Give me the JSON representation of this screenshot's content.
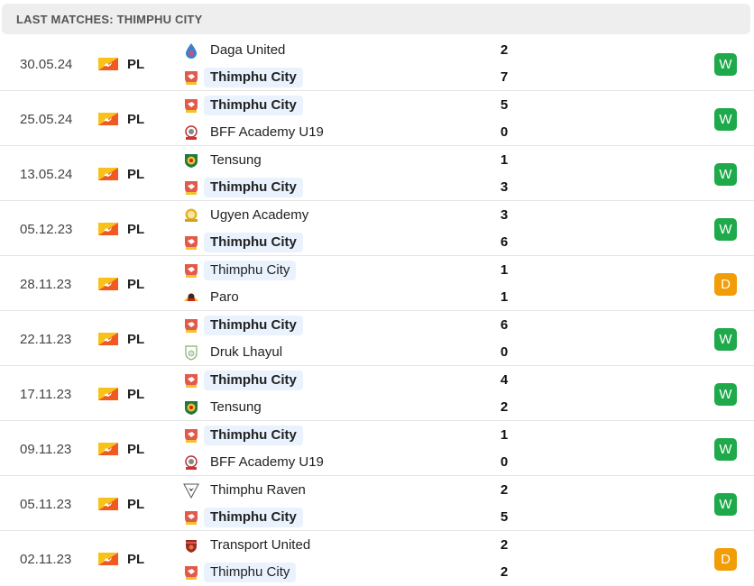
{
  "header": {
    "title": "LAST MATCHES: THIMPHU CITY"
  },
  "colors": {
    "win": "#1ea94a",
    "draw": "#f29c06",
    "highlight": "#e9f2fd"
  },
  "matches": [
    {
      "date": "30.05.24",
      "competition": "PL",
      "country_flag": "bhutan-flag-icon",
      "home": {
        "name": "Daga United",
        "crest": "daga-united-crest-icon",
        "score": "2",
        "highlight": false,
        "bold": false
      },
      "away": {
        "name": "Thimphu City",
        "crest": "thimphu-city-crest-icon",
        "score": "7",
        "highlight": true,
        "bold": true
      },
      "result": "W"
    },
    {
      "date": "25.05.24",
      "competition": "PL",
      "country_flag": "bhutan-flag-icon",
      "home": {
        "name": "Thimphu City",
        "crest": "thimphu-city-crest-icon",
        "score": "5",
        "highlight": true,
        "bold": true
      },
      "away": {
        "name": "BFF Academy U19",
        "crest": "bff-academy-crest-icon",
        "score": "0",
        "highlight": false,
        "bold": false
      },
      "result": "W"
    },
    {
      "date": "13.05.24",
      "competition": "PL",
      "country_flag": "bhutan-flag-icon",
      "home": {
        "name": "Tensung",
        "crest": "tensung-crest-icon",
        "score": "1",
        "highlight": false,
        "bold": false
      },
      "away": {
        "name": "Thimphu City",
        "crest": "thimphu-city-crest-icon",
        "score": "3",
        "highlight": true,
        "bold": true
      },
      "result": "W"
    },
    {
      "date": "05.12.23",
      "competition": "PL",
      "country_flag": "bhutan-flag-icon",
      "home": {
        "name": "Ugyen Academy",
        "crest": "ugyen-academy-crest-icon",
        "score": "3",
        "highlight": false,
        "bold": false
      },
      "away": {
        "name": "Thimphu City",
        "crest": "thimphu-city-crest-icon",
        "score": "6",
        "highlight": true,
        "bold": true
      },
      "result": "W"
    },
    {
      "date": "28.11.23",
      "competition": "PL",
      "country_flag": "bhutan-flag-icon",
      "home": {
        "name": "Thimphu City",
        "crest": "thimphu-city-crest-icon",
        "score": "1",
        "highlight": true,
        "bold": false
      },
      "away": {
        "name": "Paro",
        "crest": "paro-crest-icon",
        "score": "1",
        "highlight": false,
        "bold": false
      },
      "result": "D"
    },
    {
      "date": "22.11.23",
      "competition": "PL",
      "country_flag": "bhutan-flag-icon",
      "home": {
        "name": "Thimphu City",
        "crest": "thimphu-city-crest-icon",
        "score": "6",
        "highlight": true,
        "bold": true
      },
      "away": {
        "name": "Druk Lhayul",
        "crest": "druk-lhayul-crest-icon",
        "score": "0",
        "highlight": false,
        "bold": false
      },
      "result": "W"
    },
    {
      "date": "17.11.23",
      "competition": "PL",
      "country_flag": "bhutan-flag-icon",
      "home": {
        "name": "Thimphu City",
        "crest": "thimphu-city-crest-icon",
        "score": "4",
        "highlight": true,
        "bold": true
      },
      "away": {
        "name": "Tensung",
        "crest": "tensung-crest-icon",
        "score": "2",
        "highlight": false,
        "bold": false
      },
      "result": "W"
    },
    {
      "date": "09.11.23",
      "competition": "PL",
      "country_flag": "bhutan-flag-icon",
      "home": {
        "name": "Thimphu City",
        "crest": "thimphu-city-crest-icon",
        "score": "1",
        "highlight": true,
        "bold": true
      },
      "away": {
        "name": "BFF Academy U19",
        "crest": "bff-academy-crest-icon",
        "score": "0",
        "highlight": false,
        "bold": false
      },
      "result": "W"
    },
    {
      "date": "05.11.23",
      "competition": "PL",
      "country_flag": "bhutan-flag-icon",
      "home": {
        "name": "Thimphu Raven",
        "crest": "thimphu-raven-crest-icon",
        "score": "2",
        "highlight": false,
        "bold": false
      },
      "away": {
        "name": "Thimphu City",
        "crest": "thimphu-city-crest-icon",
        "score": "5",
        "highlight": true,
        "bold": true
      },
      "result": "W"
    },
    {
      "date": "02.11.23",
      "competition": "PL",
      "country_flag": "bhutan-flag-icon",
      "home": {
        "name": "Transport United",
        "crest": "transport-united-crest-icon",
        "score": "2",
        "highlight": false,
        "bold": false
      },
      "away": {
        "name": "Thimphu City",
        "crest": "thimphu-city-crest-icon",
        "score": "2",
        "highlight": true,
        "bold": false
      },
      "result": "D"
    }
  ]
}
